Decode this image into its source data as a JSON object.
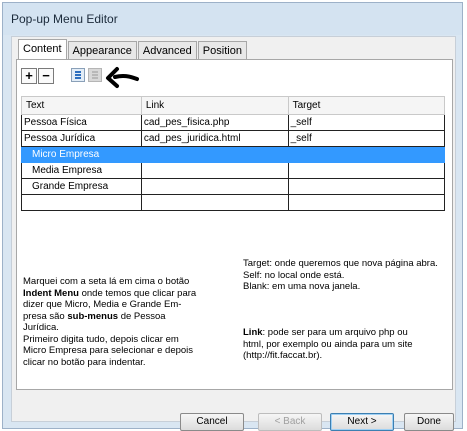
{
  "window": {
    "title": "Pop-up Menu Editor"
  },
  "tabs": [
    {
      "label": "Content",
      "active": true
    },
    {
      "label": "Appearance",
      "active": false
    },
    {
      "label": "Advanced",
      "active": false
    },
    {
      "label": "Position",
      "active": false
    }
  ],
  "toolbar": {
    "add_label": "+",
    "remove_label": "−",
    "indent_icon": "indent-icon",
    "outdent_icon": "outdent-icon",
    "arrow_icon": "hand-drawn-arrow-icon"
  },
  "table": {
    "headers": [
      "Text",
      "Link",
      "Target"
    ],
    "rows": [
      {
        "text": "Pessoa Física",
        "link": "cad_pes_fisica.php",
        "target": "_self"
      },
      {
        "text": "Pessoa Jurídica",
        "link": "cad_pes_juridica.html",
        "target": "_self"
      },
      {
        "text": "Micro Empresa",
        "link": "",
        "target": ""
      },
      {
        "text": "Media Empresa",
        "link": "",
        "target": ""
      },
      {
        "text": "Grande Empresa",
        "link": "",
        "target": ""
      }
    ]
  },
  "notes": {
    "target_lines": [
      "Target: onde queremos que nova página abra.",
      "Self: no local onde está.",
      "Blank: em uma nova janela."
    ],
    "left": {
      "p1_a": "Marquei com a seta lá em cima o botão",
      "p1_b_bold": "Indent Menu",
      "p1_b": " onde temos que clicar para",
      "p1_c": "dizer que Micro, Media e Grande Em-",
      "p1_d_a": "presa são ",
      "p1_d_bold": "sub-menus",
      "p1_d_b": " de Pessoa",
      "p1_e": "Jurídica.",
      "p2_a": "Primeiro digita tudo, depois clicar em",
      "p2_b": "Micro Empresa para selecionar e depois",
      "p2_c": "clicar no botão para indentar."
    },
    "link": {
      "bold": "Link",
      "l1": ": pode ser para um arquivo php ou",
      "l2": "html, por exemplo ou ainda para um site",
      "l3": "(http://fit.faccat.br)."
    }
  },
  "buttons": {
    "cancel": "Cancel",
    "back": "< Back",
    "next": "Next >",
    "done": "Done"
  },
  "colors": {
    "selection": "#3399ff",
    "window_frame": "#d4e3f1"
  }
}
